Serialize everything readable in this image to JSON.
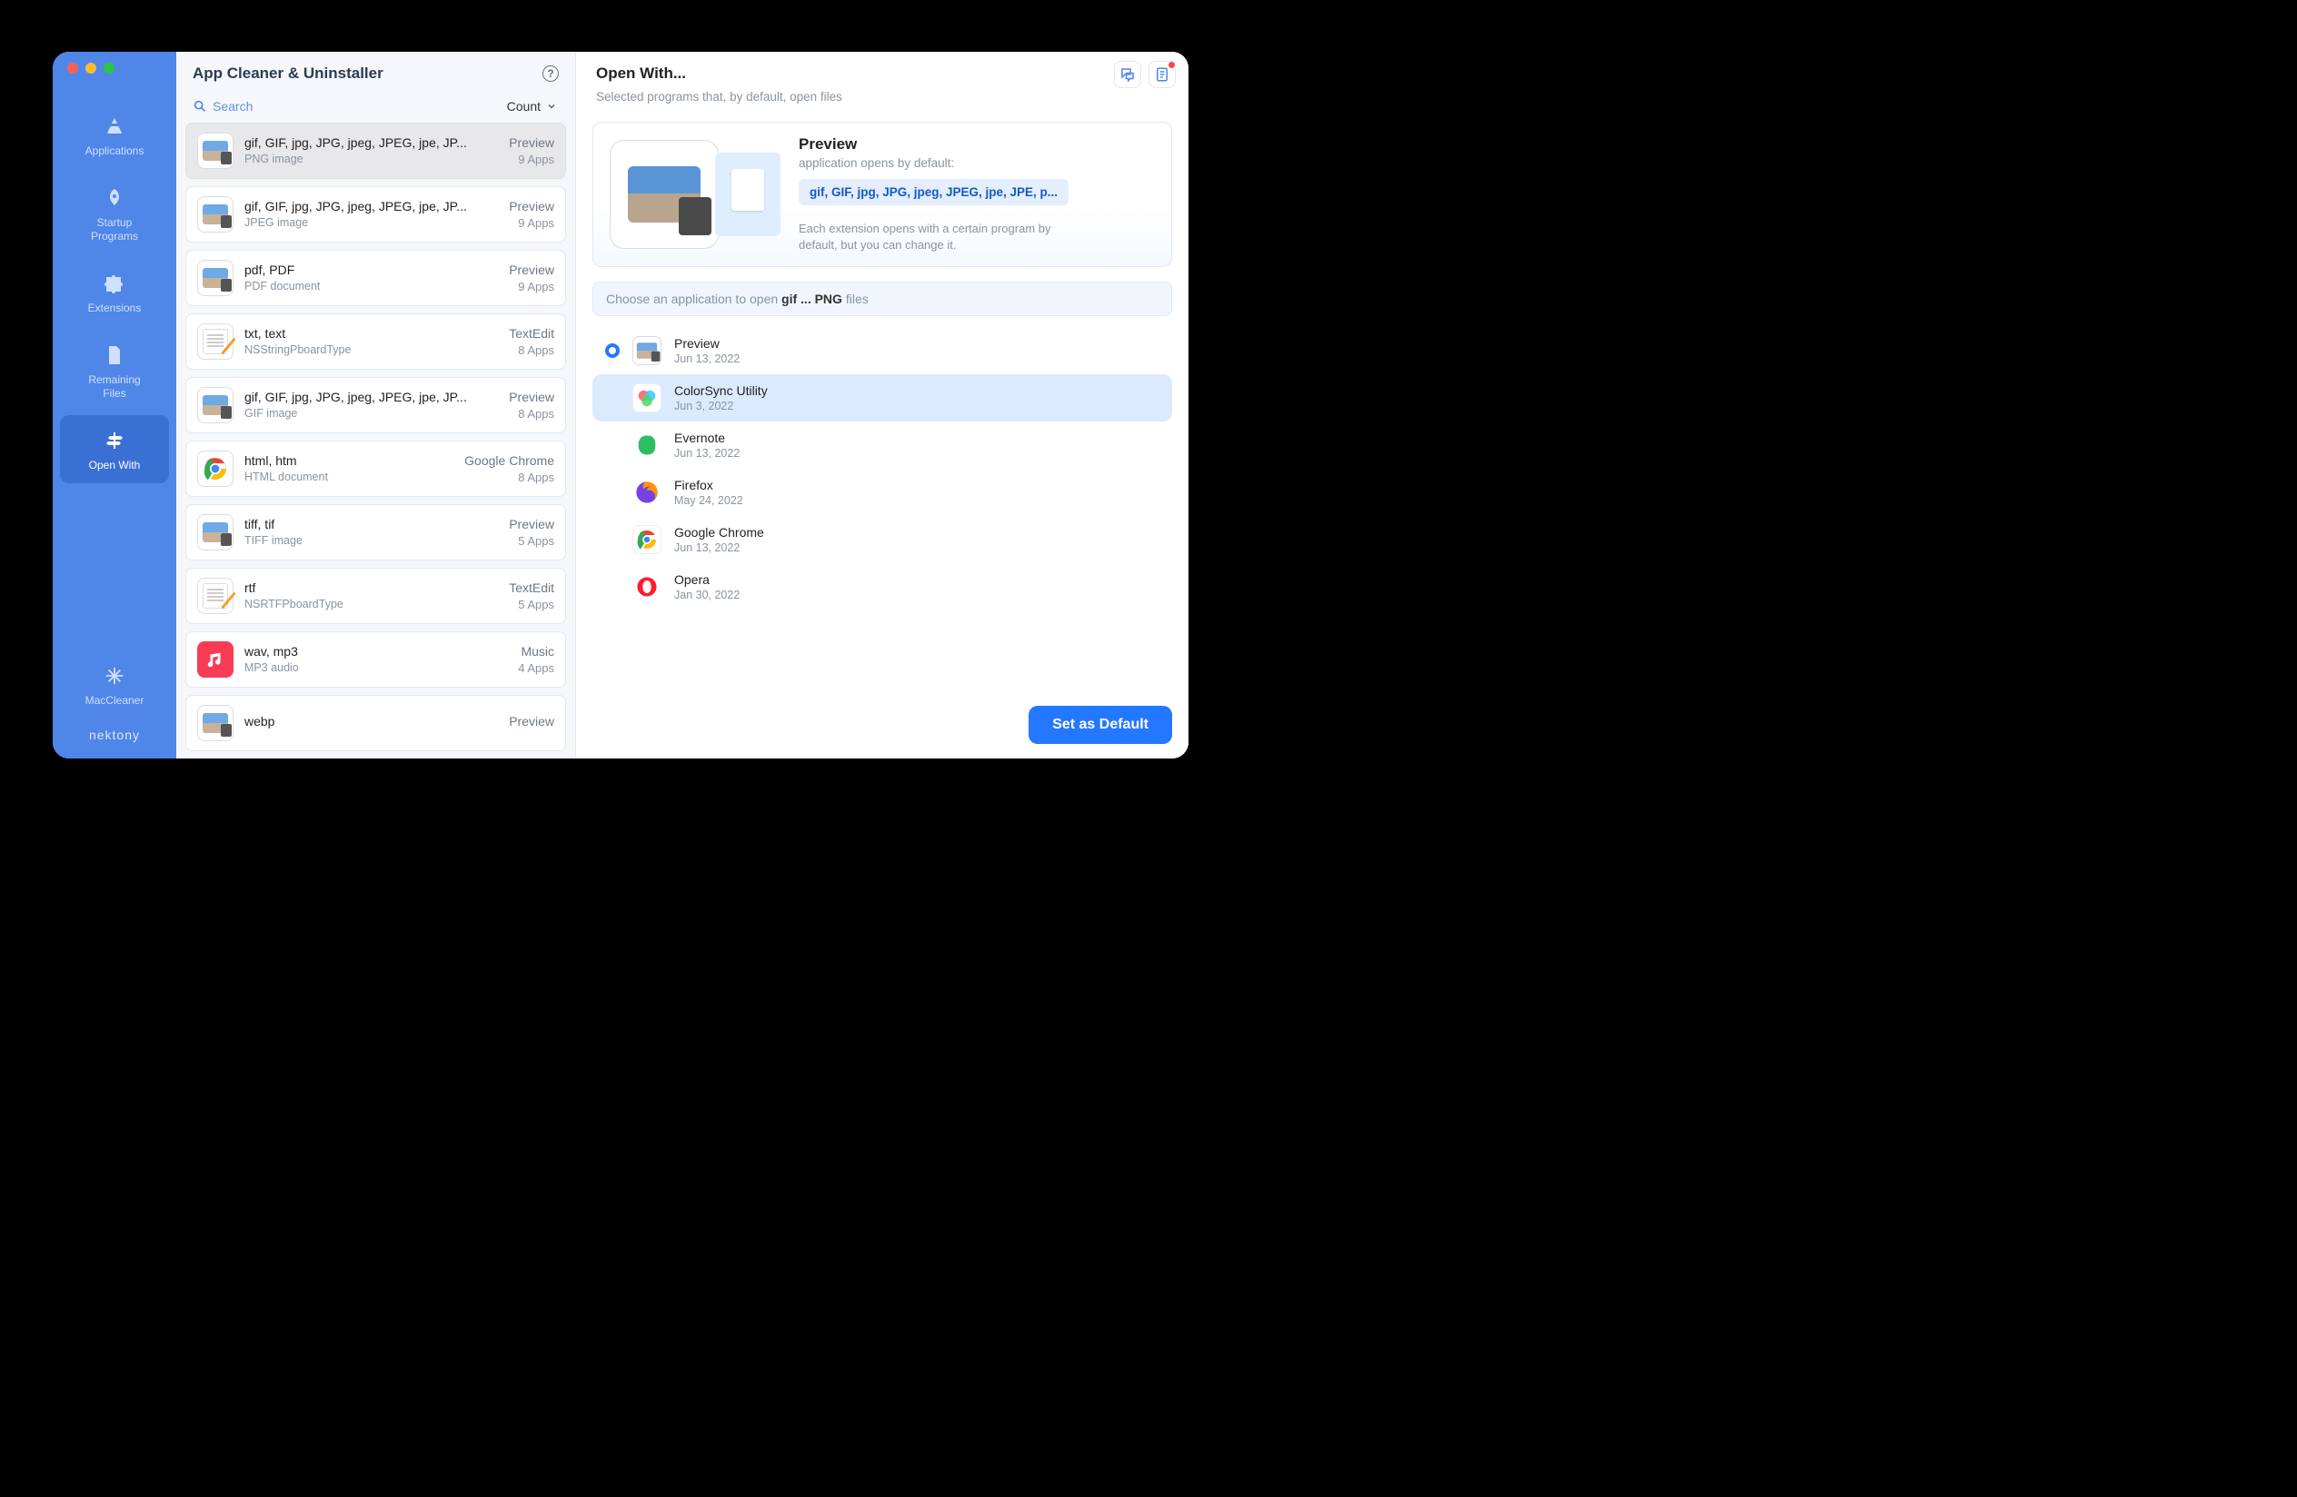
{
  "window": {
    "title": "App Cleaner & Uninstaller"
  },
  "sidebar": {
    "items": [
      {
        "label": "Applications"
      },
      {
        "label": "Startup\nPrograms"
      },
      {
        "label": "Extensions"
      },
      {
        "label": "Remaining\nFiles"
      },
      {
        "label": "Open With"
      }
    ],
    "footer": {
      "label": "MacCleaner",
      "brand": "nektony"
    }
  },
  "middle": {
    "search_placeholder": "Search",
    "sort_label": "Count",
    "items": [
      {
        "title": "gif, GIF, jpg, JPG, jpeg, JPEG, jpe, JP...",
        "sub": "PNG image",
        "right1": "Preview",
        "right2": "9 Apps",
        "icon": "preview",
        "selected": true
      },
      {
        "title": "gif, GIF, jpg, JPG, jpeg, JPEG, jpe, JP...",
        "sub": "JPEG image",
        "right1": "Preview",
        "right2": "9 Apps",
        "icon": "preview"
      },
      {
        "title": "pdf, PDF",
        "sub": "PDF document",
        "right1": "Preview",
        "right2": "9 Apps",
        "icon": "preview"
      },
      {
        "title": "txt, text",
        "sub": "NSStringPboardType",
        "right1": "TextEdit",
        "right2": "8 Apps",
        "icon": "textedit"
      },
      {
        "title": "gif, GIF, jpg, JPG, jpeg, JPEG, jpe, JP...",
        "sub": "GIF image",
        "right1": "Preview",
        "right2": "8 Apps",
        "icon": "preview"
      },
      {
        "title": "html, htm",
        "sub": "HTML document",
        "right1": "Google Chrome",
        "right2": "8 Apps",
        "icon": "chrome"
      },
      {
        "title": "tiff, tif",
        "sub": "TIFF image",
        "right1": "Preview",
        "right2": "5 Apps",
        "icon": "preview"
      },
      {
        "title": "rtf",
        "sub": "NSRTFPboardType",
        "right1": "TextEdit",
        "right2": "5 Apps",
        "icon": "textedit"
      },
      {
        "title": "wav, mp3",
        "sub": "MP3 audio",
        "right1": "Music",
        "right2": "4 Apps",
        "icon": "music"
      },
      {
        "title": "webp",
        "sub": "",
        "right1": "Preview",
        "right2": "",
        "icon": "preview"
      }
    ]
  },
  "right": {
    "title": "Open With...",
    "subtitle": "Selected programs that, by default, open files",
    "info": {
      "app_name": "Preview",
      "desc": "application opens by default:",
      "ext_pill": "gif, GIF, jpg, JPG, jpeg, JPEG, jpe, JPE, p...",
      "note": "Each extension opens with a certain program by default, but you can change it."
    },
    "choose": {
      "prefix": "Choose an application to open ",
      "bold": "gif ... PNG",
      "suffix": " files"
    },
    "apps": [
      {
        "name": "Preview",
        "date": "Jun 13, 2022",
        "icon": "preview",
        "selected": true
      },
      {
        "name": "ColorSync Utility",
        "date": "Jun 3, 2022",
        "icon": "colorsync",
        "highlight": true
      },
      {
        "name": "Evernote",
        "date": "Jun 13, 2022",
        "icon": "evernote"
      },
      {
        "name": "Firefox",
        "date": "May 24, 2022",
        "icon": "firefox"
      },
      {
        "name": "Google Chrome",
        "date": "Jun 13, 2022",
        "icon": "chrome"
      },
      {
        "name": "Opera",
        "date": "Jan 30, 2022",
        "icon": "opera"
      }
    ],
    "button": "Set as Default"
  }
}
